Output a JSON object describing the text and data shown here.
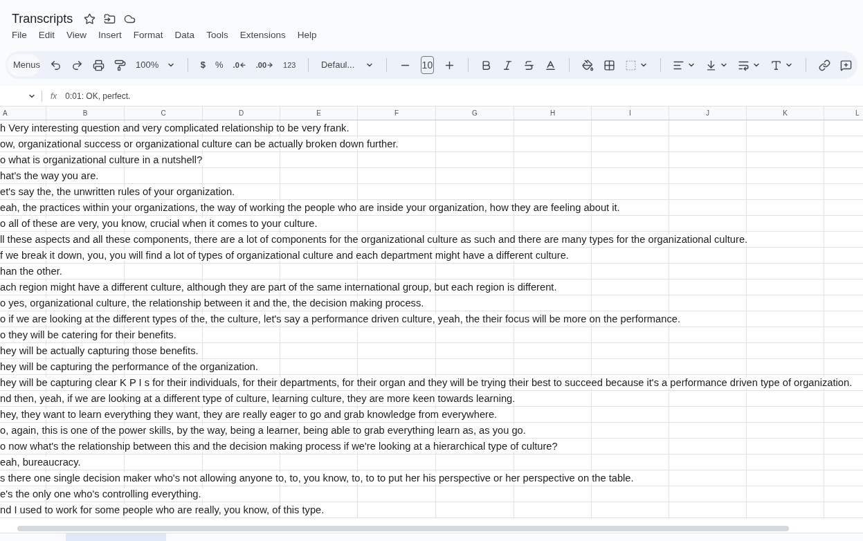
{
  "title": "Transcripts",
  "menu": [
    "File",
    "Edit",
    "View",
    "Insert",
    "Format",
    "Data",
    "Tools",
    "Extensions",
    "Help"
  ],
  "toolbar": {
    "search": "Menus",
    "zoom": "100%",
    "currency": "$",
    "percent": "%",
    "decrease_decimals": ".0",
    "increase_decimals": ".00",
    "number_format": "123",
    "font": "Defaul...",
    "font_size": "10"
  },
  "formula_bar": {
    "fx": "fx",
    "formula": "0:01: OK, perfect."
  },
  "columns": [
    "A",
    "B",
    "C",
    "D",
    "E",
    "F",
    "G",
    "H",
    "I",
    "J",
    "K",
    "L"
  ],
  "rows": [
    "h Very interesting question and very complicated relationship to be very frank.",
    "ow, organizational success or organizational culture can be actually broken down further.",
    "o what is organizational culture in a nutshell?",
    "hat's the way you are.",
    "et's say the, the unwritten rules of your organization.",
    "eah, the practices within your organizations, the way of working the people who are inside your organization, how they are feeling about it.",
    "o all of these are very, you know, crucial when it comes to your culture.",
    "ll these aspects and all these components, there are a lot of components for the organizational culture as such and there are many types for the organizational culture.",
    "f we break it down, you, you will find a lot of types of organizational culture and each department might have a different culture.",
    "han the other.",
    "ach region might have a different culture, although they are part of the same international group, but each region is different.",
    "o yes, organizational culture, the relationship between it and the, the decision making process.",
    "o if we are looking at the different types of the, the culture, let's say a performance driven culture, yeah, the their focus will be more on the performance.",
    "o they will be catering for their benefits.",
    "hey will be actually capturing those benefits.",
    "hey will be capturing the performance of the organization.",
    "hey will be capturing clear K P I s for their individuals, for their departments, for their organ and they will be trying their best to succeed because it's a performance driven type of organization.",
    "nd then, yeah, if we are looking at a different type of culture, learning culture, they are more keen towards learning.",
    "hey, they want to learn everything they want, they are really eager to go and grab knowledge from everywhere.",
    "o, again, this is one of the power skills, by the way, being a learner, being able to grab everything learn as, as you go.",
    "o now what's the relationship between this and the decision making process if we're looking at a hierarchical type of culture?",
    "eah, bureaucracy.",
    "s there one single decision maker who's not allowing anyone to, to, you know, to, to to put her his perspective or her perspective on the table.",
    "e's the only one who's controlling everything.",
    "nd I used to work for some people who are really, you know, of this type."
  ]
}
